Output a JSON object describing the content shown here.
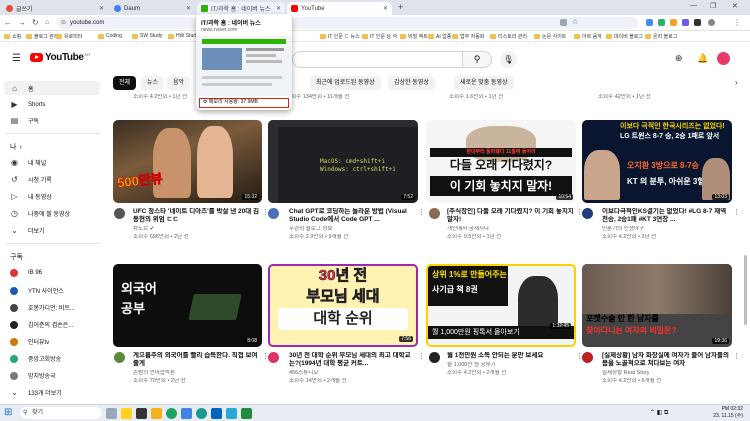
{
  "browser": {
    "tabs": [
      {
        "label": "글쓰기",
        "color": "#e94b3c"
      },
      {
        "label": "Daum",
        "color": "#3b82f6"
      },
      {
        "label": "IT/과학 홈 : 네이버 뉴스",
        "color": "#2db400"
      },
      {
        "label": "YouTube",
        "color": "#ff0000"
      }
    ],
    "new_tab": "+",
    "url": "youtube.com",
    "bookmarks": [
      "앱",
      "쇼핑",
      "블로그 관리",
      "유로미터",
      "Coding",
      "SW Study",
      "HW Study",
      "IT 인문 ㄷ 뉴스",
      "IT 인문 상 석",
      "비밀 액트드",
      "AI 업종",
      "업무 자동화",
      "티스토리 관리",
      "논문 사이트",
      "아르 음악",
      "데이버 블로그",
      "온라 블로그"
    ]
  },
  "hover_card": {
    "title": "IT/과학 홈 : 네이버 뉴스",
    "domain": "news.naver.com",
    "memory": "메모리 사용량: 37.9MB"
  },
  "youtube": {
    "logo": "YouTube",
    "region": "KR",
    "chips": [
      "전체",
      "뉴스",
      "음악",
      "최근에 업로드된 동영상",
      "감상한 동영상",
      "새로운 맞춤 동영상"
    ],
    "top_meta": [
      "조회수 4.2만회 • 1년 전",
      "조회수 134만회 • 11개월 전",
      "조회수 1.6만회 • 1년 전",
      "조회수 42만회 • 1년 전"
    ],
    "sidebar": {
      "main": [
        {
          "label": "홈",
          "icon": "home-icon",
          "glyph": "⌂"
        },
        {
          "label": "Shorts",
          "icon": "shorts-icon",
          "glyph": "▶"
        },
        {
          "label": "구독",
          "icon": "subscriptions-icon",
          "glyph": "▤"
        }
      ],
      "you_header": "나",
      "you": [
        {
          "label": "내 채널",
          "glyph": "◉"
        },
        {
          "label": "시청 기록",
          "glyph": "↺"
        },
        {
          "label": "내 동영상",
          "glyph": "▷"
        },
        {
          "label": "나중에 볼 동영상",
          "glyph": "◷"
        },
        {
          "label": "더보기",
          "glyph": "⌄"
        }
      ],
      "subs_header": "구독",
      "subs": [
        {
          "label": "IB 96",
          "color": "#d33"
        },
        {
          "label": "YTN 사이언스",
          "color": "#1a5bb8"
        },
        {
          "label": "호봉가디언: 비트...",
          "color": "#444"
        },
        {
          "label": "김어준의 겸손은...",
          "color": "#222"
        },
        {
          "label": "인터뷰tv",
          "color": "#cc7a00"
        },
        {
          "label": "중앙고회방송",
          "color": "#2a7"
        },
        {
          "label": "망치방송국",
          "color": "#777"
        },
        {
          "label": "133개 더보기",
          "color": "#fff"
        }
      ]
    },
    "videos": [
      {
        "title": "UFC 정스타 '네이트 디아즈'를 박살 낸 20대 김동현의 위엄 ㄷㄷ",
        "channel": "차도르",
        "meta": "조회수 696만회 • 2년 전",
        "duration": "15:32",
        "badge": "500만뷰"
      },
      {
        "title": "Chat GPT로 코딩하는 놀라운 방법 (Visual Studio Code에서 Code GPT ...",
        "channel": "우관의 블로그 정보",
        "meta": "조회수 2.9만회 • 9개월 전",
        "duration": "7:52",
        "code": "MacOS: cmd+shift+i\nWindows: ctrl+shift+i"
      },
      {
        "title": "[주식장인] 다들 오래 기다렸지? 이 기회 놓치지 말자!",
        "channel": "개인에서 궁재지다",
        "meta": "조회수 9.5만회 • 1년 전",
        "duration": "10:54",
        "tag": "판대부터 돌파됐다 11월에 들어라",
        "big": "다들 오래 기다렸지?",
        "big2": "이 기회 놓치지 말자!"
      },
      {
        "title": "이보다극적인KS결기는 없었다! #LG 8-7 재역전승, 2승1패 #KT 3연장 ...",
        "channel": "민훈기의 인생야구",
        "meta": "조회수 4.2만회 • 2년 전",
        "duration": "13:03",
        "sub1": "이보다 극적인 한국시리즈는 없었다!",
        "sub2": "LG 트윈스 8-7 승, 2승 1패로 앞서",
        "sub3": "오지환 3방으로 8-7승",
        "sub4": "KT 의 분투, 아쉬운 3혈살"
      },
      {
        "title": "게으름주의 외국어를 빨리 습득한다. 직접 보여줄게",
        "channel": "존범의 언어습득론",
        "meta": "조회수 70만회 • 2년 전",
        "duration": "8:08",
        "big": "외국어",
        "big2": "공부"
      },
      {
        "title": "30년 전 대학 순위 부모님 세대의 최고 대학교는?(1994년 대학 평균 커트...",
        "channel": "456스튜디오",
        "meta": "조회수 14만회 • 2개월 전",
        "duration": "7:56",
        "big": "30년 전",
        "big2": "부모님 세대",
        "big3": "대학 순위"
      },
      {
        "title": "월 1천만원 소득 안되는 분만 보세요",
        "channel": "월 1,000만 원 공부기",
        "meta": "조회수 4.2만회 • 2개월 전",
        "duration": "1:32:45",
        "big": "상위 1%로 만들어주는",
        "big2": "사기급 책 8권",
        "caption": "월 1,000만원 핑톡서 몰아보기"
      },
      {
        "title": "[실제상황] 남자 화장실에 여자가 들어 남자들의 몸을 노골적으로 쳐다보는 여자",
        "channel": "실제상황 Real Story",
        "meta": "조회수 4.2만회 • 6개월 전",
        "duration": "19:36",
        "big": "포켓수술 안 한 남자를",
        "big2": "찾아다니는 여자의 비밀은?"
      }
    ],
    "channel_check": "✔"
  },
  "taskbar": {
    "search": "찾기",
    "time": "PM 02:32",
    "date": "23. 11.15 (수)"
  }
}
